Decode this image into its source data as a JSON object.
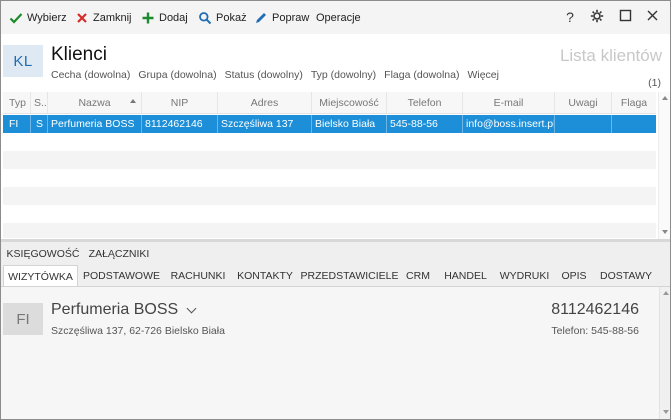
{
  "toolbar": {
    "wybierz": "Wybierz",
    "zamknij": "Zamknij",
    "dodaj": "Dodaj",
    "pokaz": "Pokaż",
    "popraw": "Popraw",
    "operacje": "Operacje",
    "help": "?",
    "icons": {
      "wybierz": "check-icon",
      "zamknij": "x-icon",
      "dodaj": "plus-icon",
      "pokaz": "search-icon",
      "popraw": "pencil-icon",
      "settings": "gear-icon",
      "maximize": "maximize-icon",
      "close": "close-icon"
    },
    "colors": {
      "check": "#1e8a2e",
      "close": "#d62b2b",
      "plus": "#1e8a2e",
      "search": "#1f6db3",
      "pencil": "#1f6db3"
    }
  },
  "header": {
    "badge": "KL",
    "title": "Klienci",
    "filters": [
      "Cecha (dowolna)",
      "Grupa (dowolna)",
      "Status (dowolny)",
      "Typ (dowolny)",
      "Flaga (dowolna)",
      "Więcej"
    ],
    "list_title": "Lista klientów",
    "count": "(1)"
  },
  "grid": {
    "columns": [
      "Typ",
      "S...",
      "Nazwa",
      "NIP",
      "Adres",
      "Miejscowość",
      "Telefon",
      "E-mail",
      "Uwagi",
      "Flaga"
    ],
    "rows": [
      [
        "FI",
        "S",
        "Perfumeria BOSS",
        "8112462146",
        "Szczęśliwa  137",
        "Bielsko Biała",
        "545-88-56",
        "info@boss.insert.pl",
        "",
        ""
      ]
    ],
    "selected_color": "#1d8fd8"
  },
  "tabs": {
    "row1": [
      "KSIĘGOWOŚĆ",
      "ZAŁĄCZNIKI"
    ],
    "row2": [
      "WIZYTÓWKA",
      "PODSTAWOWE",
      "RACHUNKI",
      "KONTAKTY",
      "PRZEDSTAWICIELE",
      "CRM",
      "HANDEL",
      "WYDRUKI",
      "OPIS",
      "DOSTAWY"
    ],
    "active": "WIZYTÓWKA"
  },
  "card": {
    "badge": "FI",
    "name": "Perfumeria BOSS",
    "address": "Szczęśliwa  137, 62-726 Bielsko Biała",
    "nip": "8112462146",
    "phone": "Telefon: 545-88-56"
  }
}
